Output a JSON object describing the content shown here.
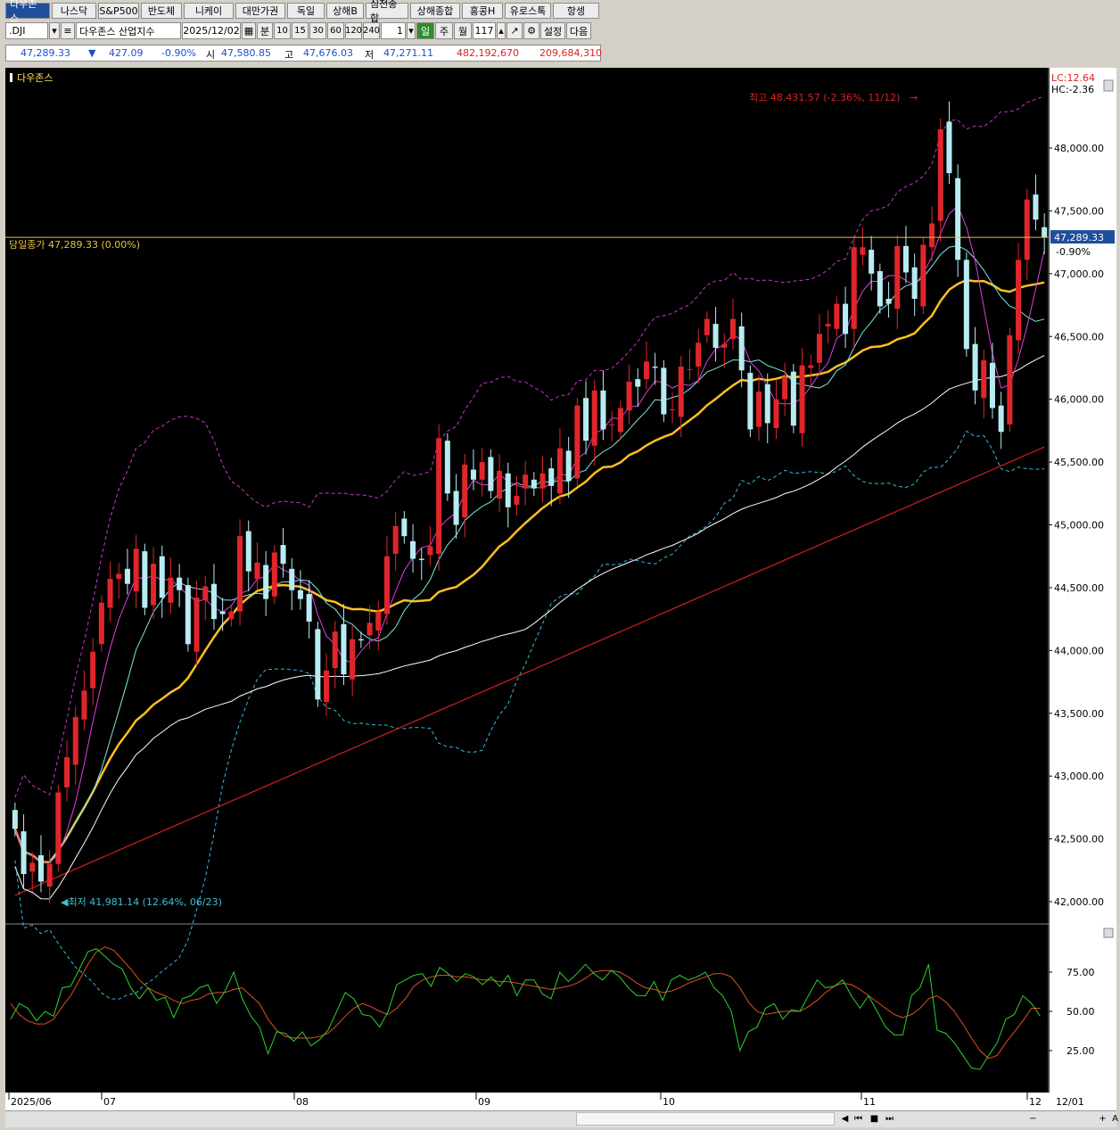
{
  "tabs": [
    "다우존스",
    "나스닥",
    "S&P500",
    "반도체",
    "니케이",
    "대만가권",
    "독일",
    "상해B",
    "심천종합",
    "상해종합",
    "홍콩H",
    "유로스톡",
    "항셍"
  ],
  "toolbar": {
    "symbol": ".DJI",
    "name_label": "다우존스 산업지수",
    "date": "2025/12/02",
    "unit_label": "분",
    "intervals": [
      "10",
      "15",
      "30",
      "60",
      "120",
      "240"
    ],
    "count_one": "1",
    "period_day": "일",
    "period_week": "주",
    "period_month": "월",
    "count": "117",
    "settings_label": "설정",
    "next_label": "다음"
  },
  "quote": {
    "price": "47,289.33",
    "arrow": "▼",
    "change": "427.09",
    "change_pct": "-0.90%",
    "open_label": "시",
    "open": "47,580.85",
    "high_label": "고",
    "high": "47,676.03",
    "low_label": "저",
    "low": "47,271.11",
    "volume": "482,192,670",
    "amount": "209,684,310"
  },
  "chart": {
    "title": "다우존스",
    "close_label": "당일종가 47,289.33 (0.00%)",
    "high_annot": "최고 48,431.57 (-2.36%, 11/12)",
    "low_annot": "최저 41,981.14 (12.64%, 06/23)",
    "lc": "LC:12.64",
    "hc": "HC:-2.36",
    "price_tag": "47,289.33",
    "pct_tag": "-0.90%",
    "colors": {
      "up": "#e0262b",
      "down": "#b8ecf2",
      "ma5": "#e040e0",
      "ma10": "#7ee8e0",
      "ma20": "#ffc020",
      "ma60": "#ffffff",
      "ma120": "#d02020",
      "band_upper": "#cc33cc",
      "band_lower": "#33bbdd",
      "stoch_k": "#30d030",
      "stoch_d": "#e05020"
    }
  },
  "chart_data": {
    "type": "candlestick",
    "ylim": [
      41800,
      48650
    ],
    "yticks": [
      "48,000.00",
      "47,500.00",
      "47,000.00",
      "46,500.00",
      "46,000.00",
      "45,500.00",
      "45,000.00",
      "44,500.00",
      "44,000.00",
      "43,500.00",
      "43,000.00",
      "42,500.00",
      "42,000.00"
    ],
    "ytick_values": [
      48000,
      47500,
      47000,
      46500,
      46000,
      45500,
      45000,
      44500,
      44000,
      43500,
      43000,
      42500,
      42000
    ],
    "xticks": [
      "2025/06",
      "07",
      "08",
      "09",
      "10",
      "11",
      "12"
    ],
    "stoch_yticks": [
      "75.00",
      "50.00",
      "25.00"
    ],
    "stoch_ytick_values": [
      75,
      50,
      25
    ],
    "closes": [
      42580,
      42220,
      42310,
      42160,
      42300,
      42870,
      43150,
      43470,
      43680,
      43990,
      44380,
      44570,
      44610,
      44530,
      44810,
      44340,
      44690,
      44420,
      44580,
      44480,
      44050,
      44420,
      44510,
      44250,
      44290,
      44310,
      44910,
      44630,
      44700,
      44410,
      44780,
      44690,
      44480,
      44410,
      44230,
      43610,
      43840,
      44150,
      43810,
      44090,
      44080,
      44220,
      44310,
      44750,
      44990,
      44910,
      44730,
      44720,
      44830,
      45690,
      45250,
      45000,
      45480,
      45360,
      45500,
      45270,
      45430,
      45140,
      45230,
      45400,
      45290,
      45410,
      45310,
      45610,
      45350,
      45950,
      45670,
      46070,
      45760,
      45800,
      45930,
      46140,
      46100,
      46300,
      46250,
      45880,
      45920,
      46260,
      46240,
      46450,
      46640,
      46410,
      46440,
      46640,
      46230,
      45760,
      46060,
      45810,
      46000,
      46180,
      45790,
      46270,
      46270,
      46520,
      46600,
      46760,
      46520,
      47210,
      47210,
      47000,
      46740,
      46760,
      47220,
      47010,
      46800,
      47230,
      47400,
      48150,
      47800,
      47110,
      46400,
      46070,
      46310,
      45930,
      45740,
      46510,
      47110,
      47590,
      47430,
      47289
    ],
    "stoch_k": [
      45,
      55,
      52,
      44,
      50,
      47,
      65,
      66,
      77,
      88,
      90,
      85,
      80,
      77,
      65,
      58,
      65,
      57,
      59,
      46,
      58,
      60,
      65,
      67,
      55,
      63,
      75,
      58,
      47,
      40,
      23,
      37,
      36,
      31,
      37,
      28,
      32,
      38,
      50,
      62,
      58,
      48,
      47,
      40,
      50,
      67,
      70,
      73,
      74,
      66,
      78,
      74,
      69,
      74,
      72,
      67,
      72,
      66,
      73,
      60,
      70,
      70,
      61,
      58,
      75,
      69,
      74,
      80,
      74,
      70,
      76,
      72,
      65,
      60,
      60,
      69,
      57,
      70,
      73,
      70,
      72,
      75,
      65,
      60,
      50,
      25,
      37,
      40,
      52,
      55,
      45,
      51,
      50,
      60,
      70,
      65,
      66,
      70,
      60,
      52,
      60,
      50,
      40,
      35,
      35,
      60,
      65,
      80,
      38,
      36,
      30,
      22,
      14,
      13,
      22,
      30,
      45,
      48,
      60,
      55,
      47
    ],
    "stoch_d": [
      55,
      48,
      44,
      42,
      42,
      45,
      53,
      60,
      70,
      80,
      88,
      91,
      89,
      83,
      77,
      70,
      65,
      62,
      60,
      57,
      55,
      57,
      58,
      61,
      62,
      62,
      64,
      65,
      60,
      55,
      45,
      38,
      34,
      33,
      33,
      33,
      34,
      36,
      41,
      47,
      52,
      55,
      53,
      50,
      48,
      52,
      58,
      66,
      70,
      72,
      73,
      73,
      72,
      72,
      71,
      70,
      70,
      69,
      69,
      68,
      67,
      66,
      65,
      64,
      65,
      66,
      68,
      71,
      75,
      76,
      76,
      75,
      72,
      68,
      65,
      64,
      62,
      63,
      65,
      68,
      70,
      72,
      74,
      74,
      72,
      65,
      56,
      50,
      48,
      49,
      50,
      50,
      50,
      53,
      57,
      62,
      66,
      68,
      67,
      64,
      60,
      56,
      52,
      48,
      46,
      48,
      52,
      58,
      60,
      56,
      50,
      42,
      33,
      25,
      20,
      22,
      30,
      37,
      44,
      52,
      52
    ]
  },
  "scroll_controls": [
    "◀",
    "⏮",
    "■",
    "⏭",
    "−",
    "+",
    "A"
  ]
}
